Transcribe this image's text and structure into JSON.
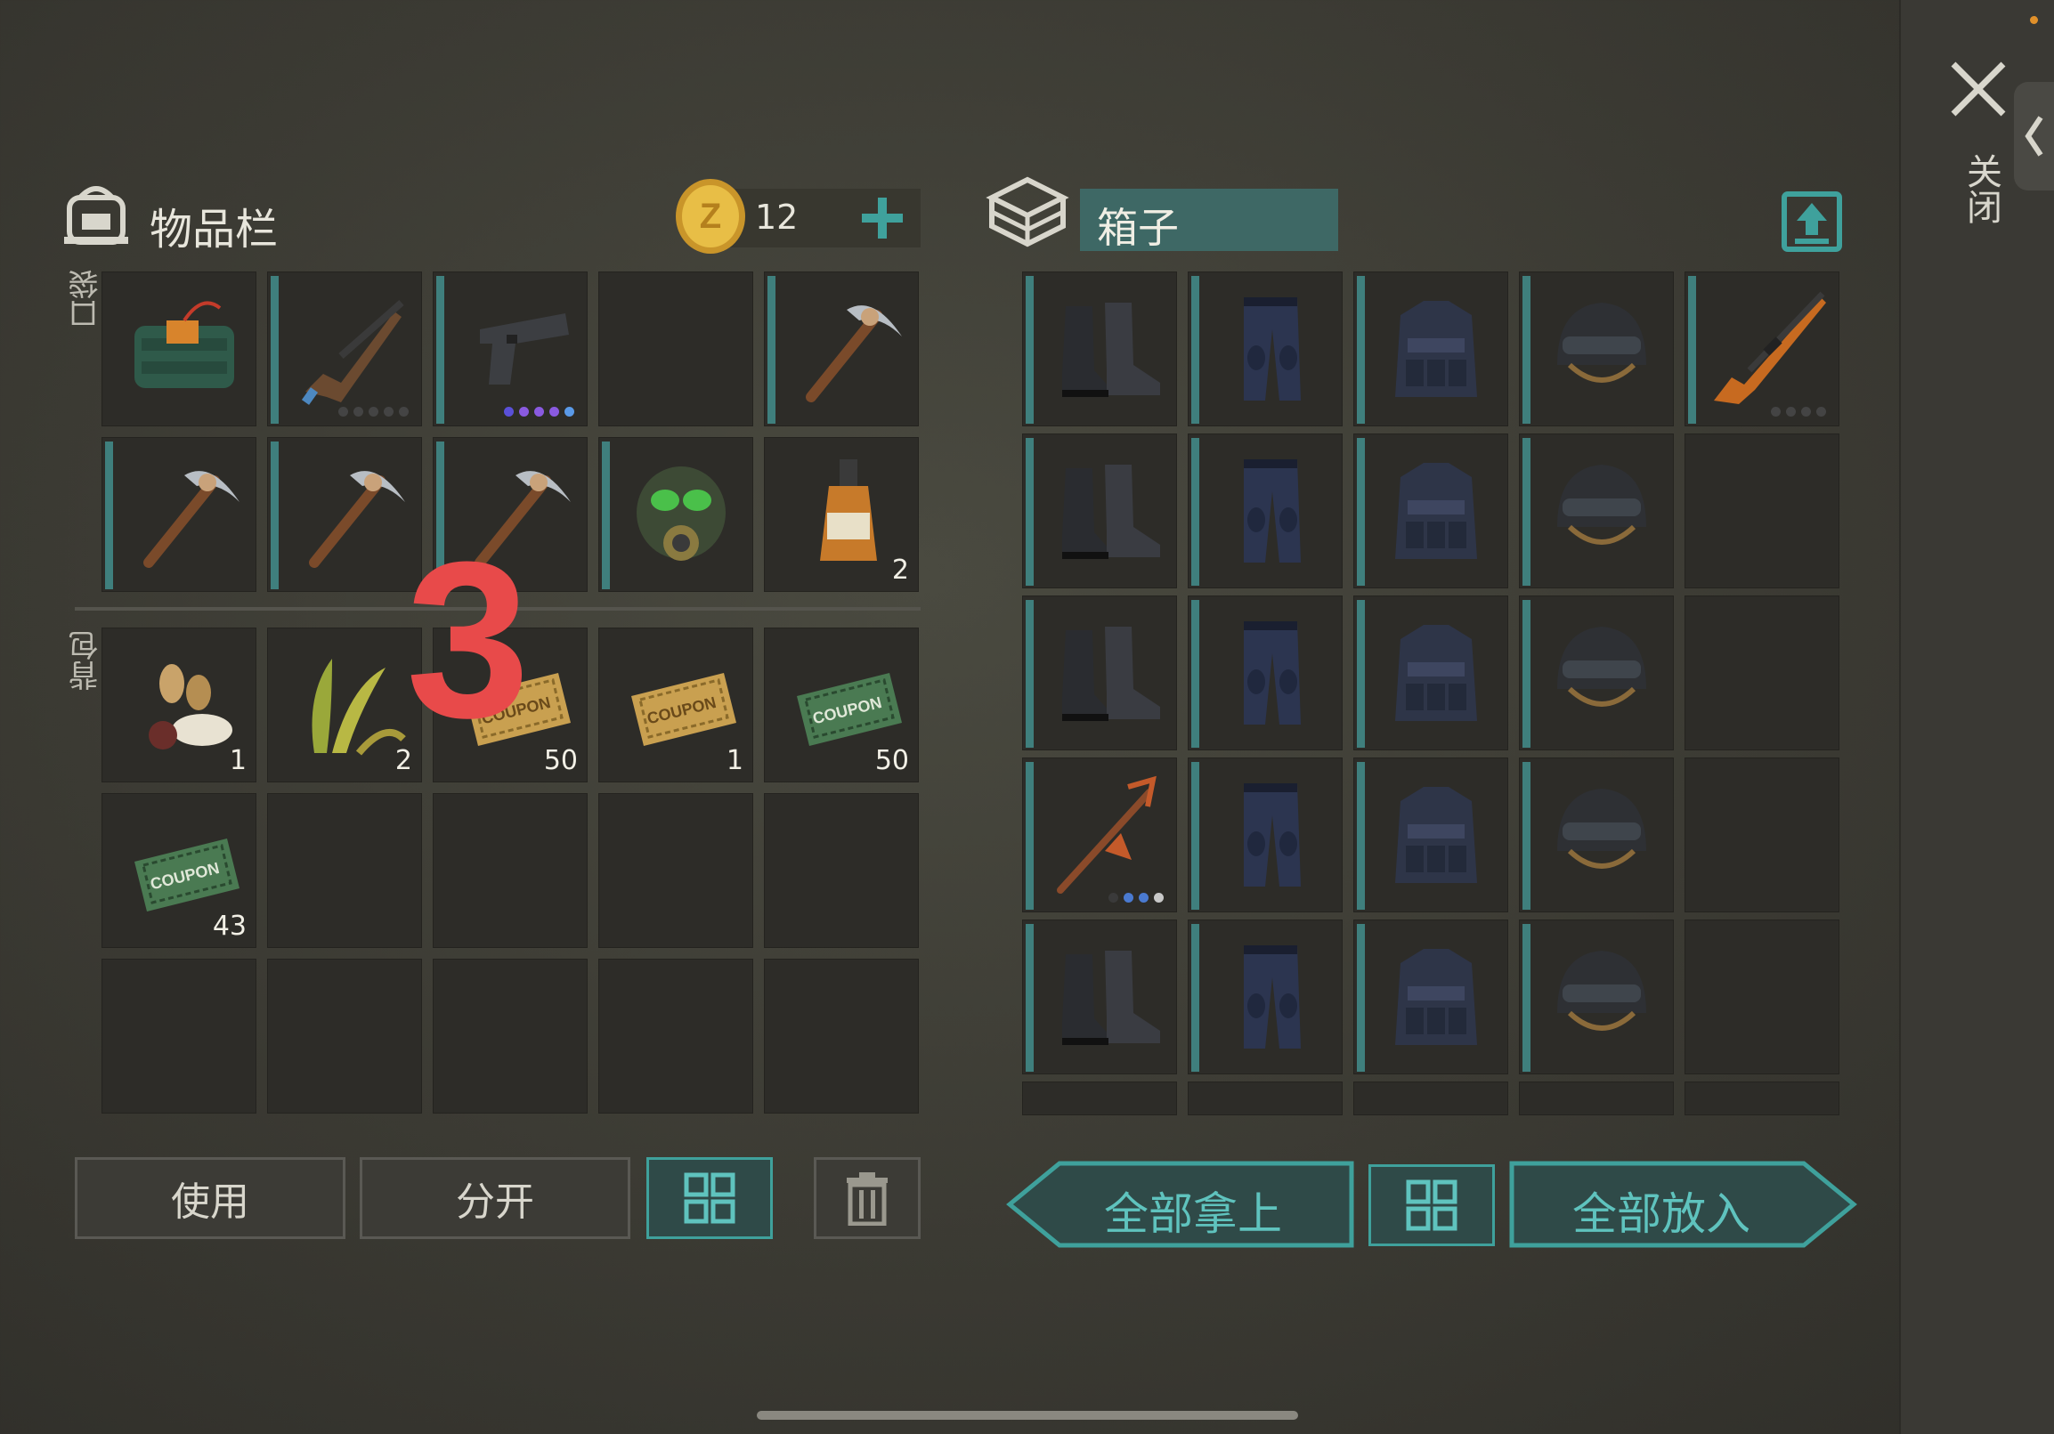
{
  "inventory": {
    "title": "物品栏",
    "coins": "12",
    "pocket_label": "口袋",
    "backpack_label": "背包",
    "pocket_slots": [
      {
        "item": "c4-explosive",
        "qty": "",
        "bar": false
      },
      {
        "item": "ak-rifle",
        "qty": "",
        "bar": true,
        "dots": [
          "#444",
          "#444",
          "#444",
          "#444",
          "#444"
        ]
      },
      {
        "item": "pistol",
        "qty": "",
        "bar": true,
        "dots": [
          "#5a50d8",
          "#8a5ae0",
          "#8a5ae0",
          "#8a5ae0",
          "#5a9ae8"
        ]
      },
      {
        "item": "",
        "qty": "",
        "bar": false
      },
      {
        "item": "pickaxe",
        "qty": "",
        "bar": true
      },
      {
        "item": "pickaxe",
        "qty": "",
        "bar": true
      },
      {
        "item": "pickaxe",
        "qty": "",
        "bar": true
      },
      {
        "item": "pickaxe",
        "qty": "",
        "bar": true
      },
      {
        "item": "gas-mask",
        "qty": "",
        "bar": true
      },
      {
        "item": "whiskey-bottle",
        "qty": "2",
        "bar": false
      }
    ],
    "backpack_slots": [
      {
        "item": "seeds",
        "qty": "1"
      },
      {
        "item": "plant-leaves",
        "qty": "2"
      },
      {
        "item": "survival-kit-coupon",
        "qty": "50"
      },
      {
        "item": "survival-kit-coupon",
        "qty": "1"
      },
      {
        "item": "ration-coupon",
        "qty": "50"
      },
      {
        "item": "ration-coupon",
        "qty": "43"
      },
      {
        "item": "",
        "qty": ""
      },
      {
        "item": "",
        "qty": ""
      },
      {
        "item": "",
        "qty": ""
      },
      {
        "item": "",
        "qty": ""
      },
      {
        "item": "",
        "qty": ""
      },
      {
        "item": "",
        "qty": ""
      },
      {
        "item": "",
        "qty": ""
      },
      {
        "item": "",
        "qty": ""
      },
      {
        "item": "",
        "qty": ""
      }
    ],
    "buttons": {
      "use": "使用",
      "split": "分开"
    }
  },
  "box": {
    "title": "箱子",
    "rows": [
      [
        "boots",
        "pants",
        "police-vest",
        "helmet",
        "sniper-rifle"
      ],
      [
        "boots",
        "pants",
        "police-vest",
        "helmet",
        ""
      ],
      [
        "boots",
        "pants",
        "police-vest",
        "helmet",
        ""
      ],
      [
        "crossbow-pickaxe",
        "pants",
        "police-vest",
        "helmet",
        ""
      ],
      [
        "boots",
        "pants",
        "police-vest",
        "helmet",
        ""
      ]
    ],
    "buttons": {
      "take_all": "全部拿上",
      "put_all": "全部放入"
    }
  },
  "close_label": "关闭",
  "overlay_number": "3",
  "colors": {
    "accent": "#3fa19c",
    "overlay": "#e84a4a",
    "coin": "#e0b23a"
  }
}
